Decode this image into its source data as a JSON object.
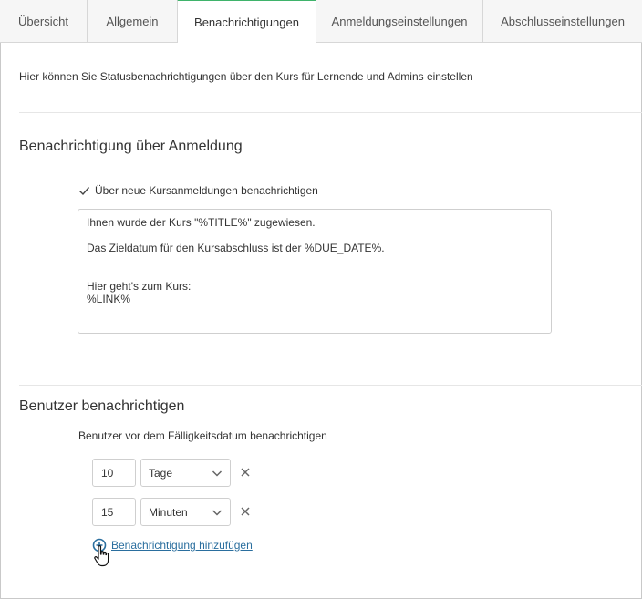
{
  "tabs": [
    {
      "label": "Übersicht"
    },
    {
      "label": "Allgemein"
    },
    {
      "label": "Benachrichtigungen"
    },
    {
      "label": "Anmeldungseinstellungen"
    },
    {
      "label": "Abschlusseinstellungen"
    }
  ],
  "intro_text": "Hier können Sie Statusbenachrichtigungen über den Kurs für Lernende und Admins einstellen",
  "enrollment_section": {
    "title": "Benachrichtigung über Anmeldung",
    "checkbox_label": "Über neue Kursanmeldungen benachrichtigen",
    "checkbox_checked": true,
    "message": "Ihnen wurde der Kurs \"%TITLE%\" zugewiesen.\n\nDas Zieldatum für den Kursabschluss ist der %DUE_DATE%.\n\n\nHier geht's zum Kurs:\n%LINK%"
  },
  "notify_section": {
    "title": "Benutzer benachrichtigen",
    "sub_label": "Benutzer vor dem Fälligkeitsdatum benachrichtigen",
    "reminders": [
      {
        "amount": "10",
        "unit": "Tage"
      },
      {
        "amount": "15",
        "unit": "Minuten"
      }
    ],
    "add_label": "Benachrichtigung hinzufügen"
  },
  "colors": {
    "accent": "#3fb36b",
    "link": "#2a6e9e"
  }
}
